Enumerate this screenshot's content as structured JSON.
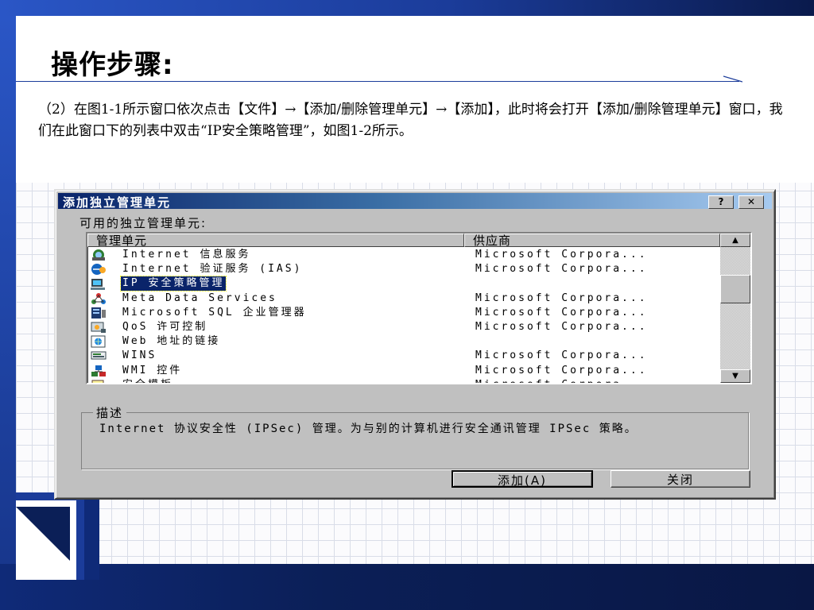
{
  "slide": {
    "title": "操作步骤:",
    "body": "（2）在图1-1所示窗口依次点击【文件】→【添加/删除管理单元】→【添加】，此时将会打开【添加/删除管理单元】窗口，我们在此窗口下的列表中双击“IP安全策略管理”，如图1-2所示。"
  },
  "dialog": {
    "title": "添加独立管理单元",
    "help_label": "?",
    "close_label": "✕",
    "available_label": "可用的独立管理单元:",
    "columns": {
      "snapin": "管理单元",
      "vendor": "供应商"
    },
    "rows": [
      {
        "name": "Internet 信息服务",
        "vendor": "Microsoft Corpora...",
        "icon": "iis-icon"
      },
      {
        "name": "Internet 验证服务 (IAS)",
        "vendor": "Microsoft Corpora...",
        "icon": "ias-icon"
      },
      {
        "name": "IP 安全策略管理",
        "vendor": "",
        "icon": "ip-security-icon",
        "selected": true
      },
      {
        "name": "Meta Data Services",
        "vendor": "Microsoft Corpora...",
        "icon": "meta-data-icon"
      },
      {
        "name": "Microsoft SQL 企业管理器",
        "vendor": "Microsoft Corpora...",
        "icon": "sql-server-icon"
      },
      {
        "name": "QoS 许可控制",
        "vendor": "Microsoft Corpora...",
        "icon": "qos-icon"
      },
      {
        "name": "Web 地址的链接",
        "vendor": "",
        "icon": "web-link-icon"
      },
      {
        "name": "WINS",
        "vendor": "Microsoft Corpora...",
        "icon": "wins-icon"
      },
      {
        "name": "WMI 控件",
        "vendor": "Microsoft Corpora...",
        "icon": "wmi-icon"
      },
      {
        "name": "安全模板",
        "vendor": "Microsoft Corpora...",
        "icon": "security-template-icon"
      }
    ],
    "scroll_up": "▲",
    "scroll_down": "▼",
    "description_label": "描述",
    "description_text": "Internet 协议安全性 (IPSec) 管理。为与别的计算机进行安全通讯管理 IPSec 策略。",
    "add_button": "添加(A)",
    "close_button": "关闭"
  }
}
